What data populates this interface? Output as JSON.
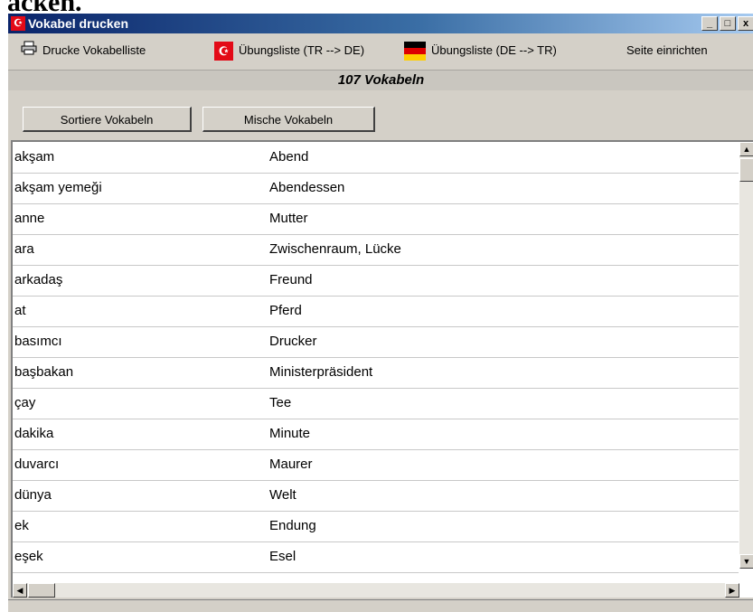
{
  "background_text": "acken.",
  "window": {
    "title": "Vokabel drucken",
    "title_flag_glyph": "☪",
    "controls": {
      "minimize": "_",
      "maximize": "□",
      "close": "x"
    }
  },
  "toolbar": {
    "print_list": "Drucke Vokabelliste",
    "exercise_tr_de": "Übungsliste (TR --> DE)",
    "exercise_de_tr": "Übungsliste (DE --> TR)",
    "page_setup": "Seite einrichten",
    "icons": {
      "print": "printer-icon",
      "tr": "turkey-flag-icon",
      "de": "germany-flag-icon"
    }
  },
  "count_label": "107 Vokabeln",
  "buttons": {
    "sort": "Sortiere Vokabeln",
    "shuffle": "Mische Vokabeln"
  },
  "vocab": [
    {
      "tr": "akşam",
      "de": "Abend"
    },
    {
      "tr": "akşam yemeği",
      "de": "Abendessen"
    },
    {
      "tr": "anne",
      "de": "Mutter"
    },
    {
      "tr": "ara",
      "de": "Zwischenraum, Lücke"
    },
    {
      "tr": "arkadaş",
      "de": "Freund"
    },
    {
      "tr": "at",
      "de": "Pferd"
    },
    {
      "tr": "basımcı",
      "de": "Drucker"
    },
    {
      "tr": "başbakan",
      "de": "Ministerpräsident"
    },
    {
      "tr": "çay",
      "de": "Tee"
    },
    {
      "tr": "dakika",
      "de": "Minute"
    },
    {
      "tr": "duvarcı",
      "de": "Maurer"
    },
    {
      "tr": "dünya",
      "de": "Welt"
    },
    {
      "tr": "ek",
      "de": "Endung"
    },
    {
      "tr": "eşek",
      "de": "Esel"
    }
  ],
  "colors": {
    "title_start": "#0a246a",
    "title_end": "#a6caf0",
    "window_face": "#d4d0c8",
    "tr_flag": "#e30a17"
  }
}
